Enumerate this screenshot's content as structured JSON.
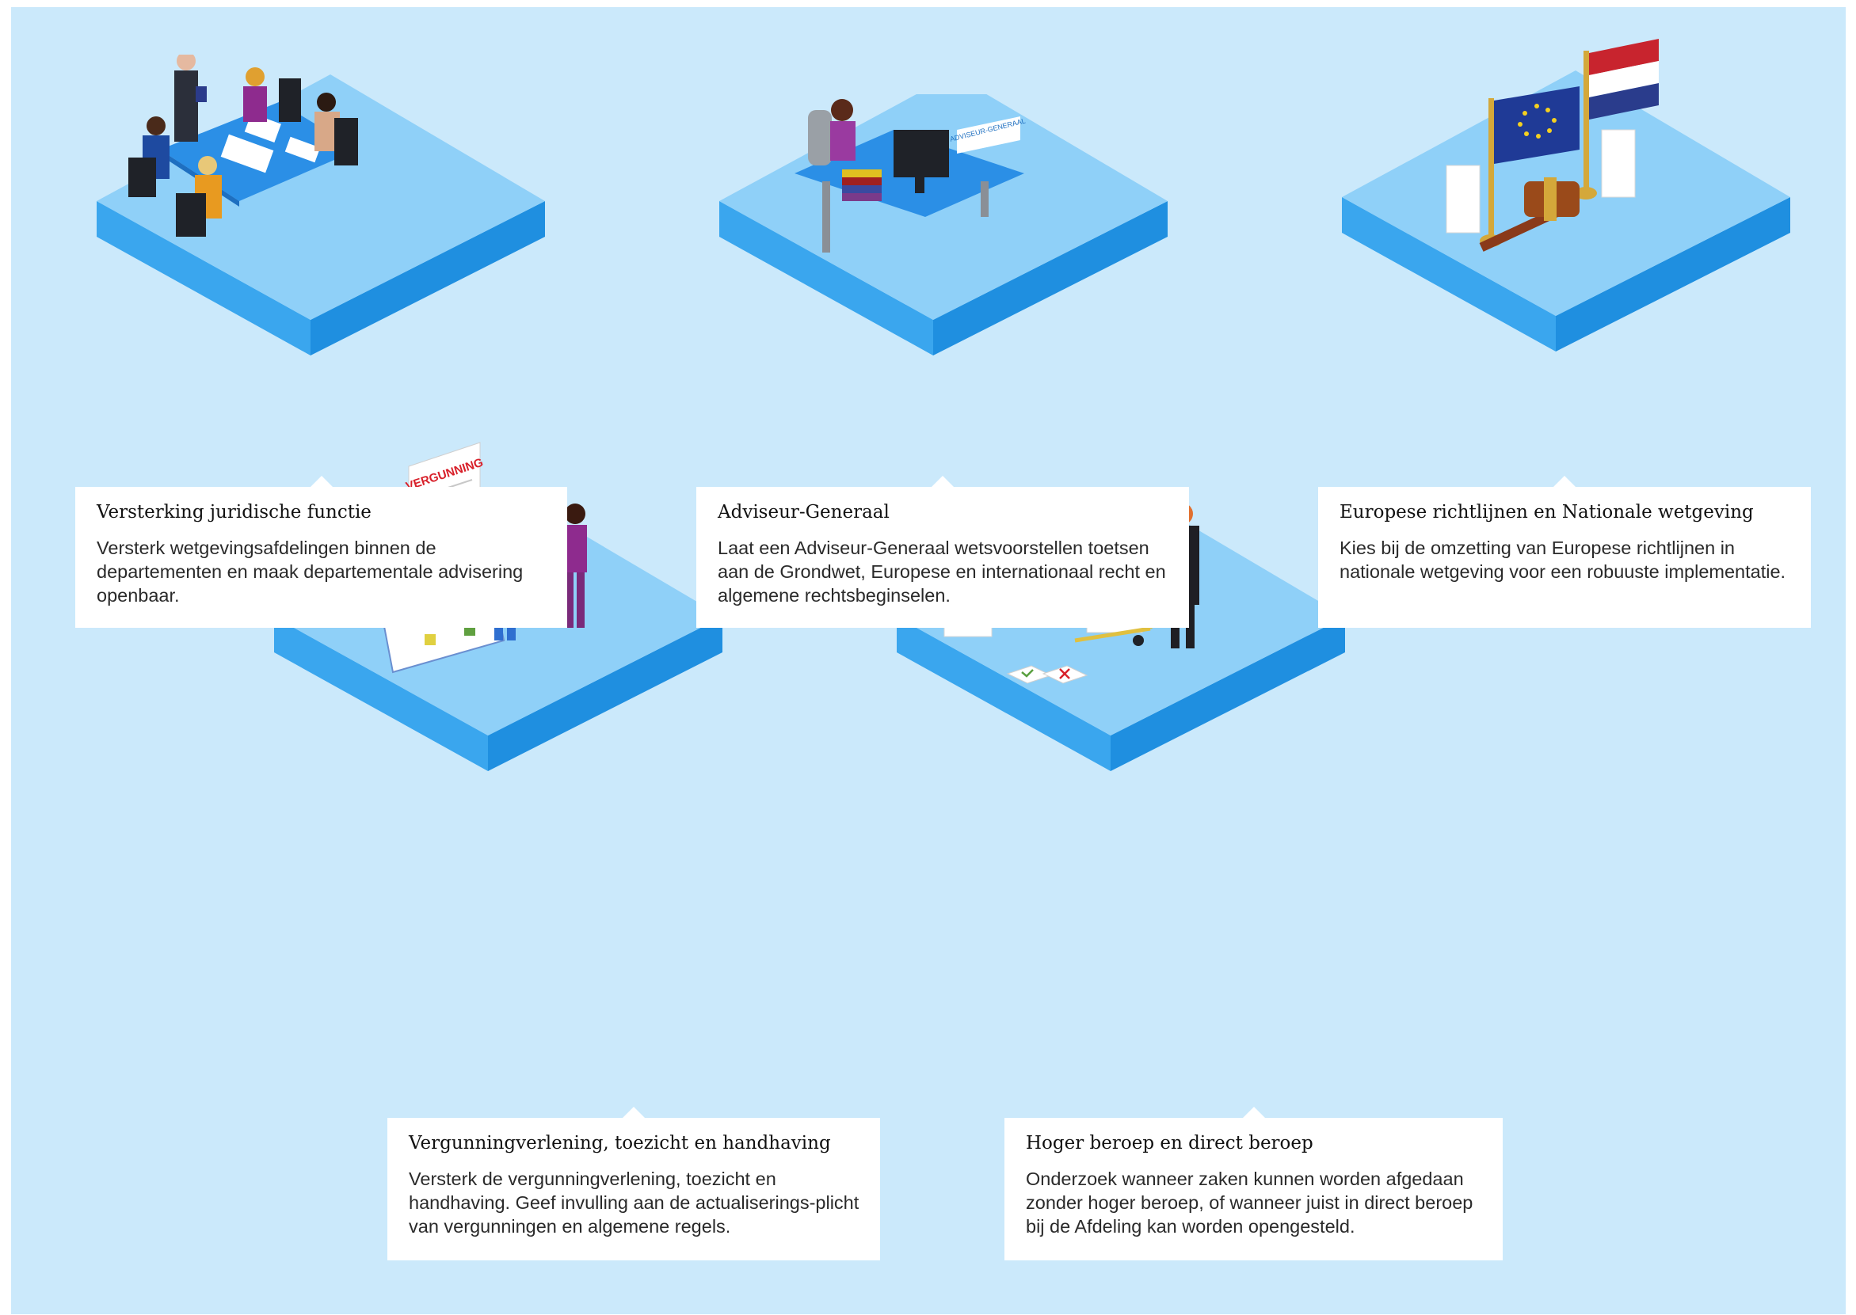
{
  "colors": {
    "background": "#cbe9fb",
    "platform_top": "#8fd0f8",
    "platform_side": "#35a2ec",
    "card": "#ffffff"
  },
  "scenes": [
    {
      "icon": "meeting-table-icon"
    },
    {
      "icon": "desk-computer-icon",
      "desk_sign": "ADVISEUR-GENERAAL"
    },
    {
      "icon": "flags-gavel-icon"
    },
    {
      "icon": "permit-calendar-icon",
      "document_title": "VERGUNNING"
    },
    {
      "icon": "judge-paper-stacks-icon"
    }
  ],
  "cards": [
    {
      "title": "Versterking juridische functie",
      "body": "Versterk wetgevingsafdelingen binnen de departementen en maak departementale advisering openbaar."
    },
    {
      "title": "Adviseur-Generaal",
      "body": "Laat een Adviseur-Generaal wetsvoorstellen toetsen aan de Grondwet, Europese en internationaal recht en algemene rechtsbeginselen."
    },
    {
      "title": "Europese richtlijnen en Nationale wetgeving",
      "body": "Kies bij de omzetting van Europese richtlijnen in nationale wetgeving voor een robuuste implementatie."
    },
    {
      "title": "Vergunningverlening, toezicht en handhaving",
      "body": "Versterk de vergunningverlening, toezicht en handhaving. Geef invulling aan de actualiserings-plicht van vergunningen en algemene regels."
    },
    {
      "title": "Hoger beroep en direct beroep",
      "body": "Onderzoek wanneer zaken kunnen worden afgedaan zonder hoger beroep, of wanneer juist in direct beroep bij de Afdeling kan worden opengesteld."
    }
  ]
}
